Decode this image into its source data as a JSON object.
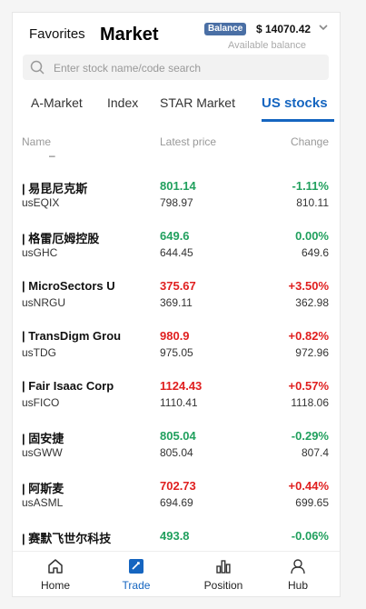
{
  "header": {
    "favorites_label": "Favorites",
    "market_label": "Market",
    "balance_badge": "Balance",
    "balance_amount": "$ 14070.42",
    "balance_sub": "Available balance"
  },
  "search": {
    "placeholder": "Enter stock name/code search"
  },
  "tabs": [
    {
      "label": "A-Market"
    },
    {
      "label": "Index"
    },
    {
      "label": "STAR Market"
    },
    {
      "label": "US stocks"
    }
  ],
  "columns": {
    "name": "Name",
    "price": "Latest price",
    "change": "Change"
  },
  "placeholder_dash": "–",
  "colors": {
    "up": "#e02020",
    "down": "#21a05e",
    "accent": "#1565c0"
  },
  "stocks": [
    {
      "name": "| 易昆尼克斯",
      "code": "usEQIX",
      "price": "801.14",
      "prev": "798.97",
      "change": "-1.11%",
      "ref": "810.11",
      "dir": "down"
    },
    {
      "name": "| 格雷厄姆控股",
      "code": "usGHC",
      "price": "649.6",
      "prev": "644.45",
      "change": "0.00%",
      "ref": "649.6",
      "dir": "down"
    },
    {
      "name": "| MicroSectors U",
      "code": "usNRGU",
      "price": "375.67",
      "prev": "369.11",
      "change": "+3.50%",
      "ref": "362.98",
      "dir": "up"
    },
    {
      "name": "| TransDigm Grou",
      "code": "usTDG",
      "price": "980.9",
      "prev": "975.05",
      "change": "+0.82%",
      "ref": "972.96",
      "dir": "up"
    },
    {
      "name": "| Fair Isaac Corp",
      "code": "usFICO",
      "price": "1124.43",
      "prev": "1110.41",
      "change": "+0.57%",
      "ref": "1118.06",
      "dir": "up"
    },
    {
      "name": "| 固安捷",
      "code": "usGWW",
      "price": "805.04",
      "prev": "805.04",
      "change": "-0.29%",
      "ref": "807.4",
      "dir": "down"
    },
    {
      "name": "| 阿斯麦",
      "code": "usASML",
      "price": "702.73",
      "prev": "694.69",
      "change": "+0.44%",
      "ref": "699.65",
      "dir": "up"
    },
    {
      "name": "| 赛默飞世尔科技",
      "code": "",
      "price": "493.8",
      "prev": "",
      "change": "-0.06%",
      "ref": "",
      "dir": "down"
    }
  ],
  "nav": [
    {
      "label": "Home",
      "icon": "home-icon"
    },
    {
      "label": "Trade",
      "icon": "trade-icon"
    },
    {
      "label": "Position",
      "icon": "position-icon"
    },
    {
      "label": "Hub",
      "icon": "hub-icon"
    }
  ]
}
